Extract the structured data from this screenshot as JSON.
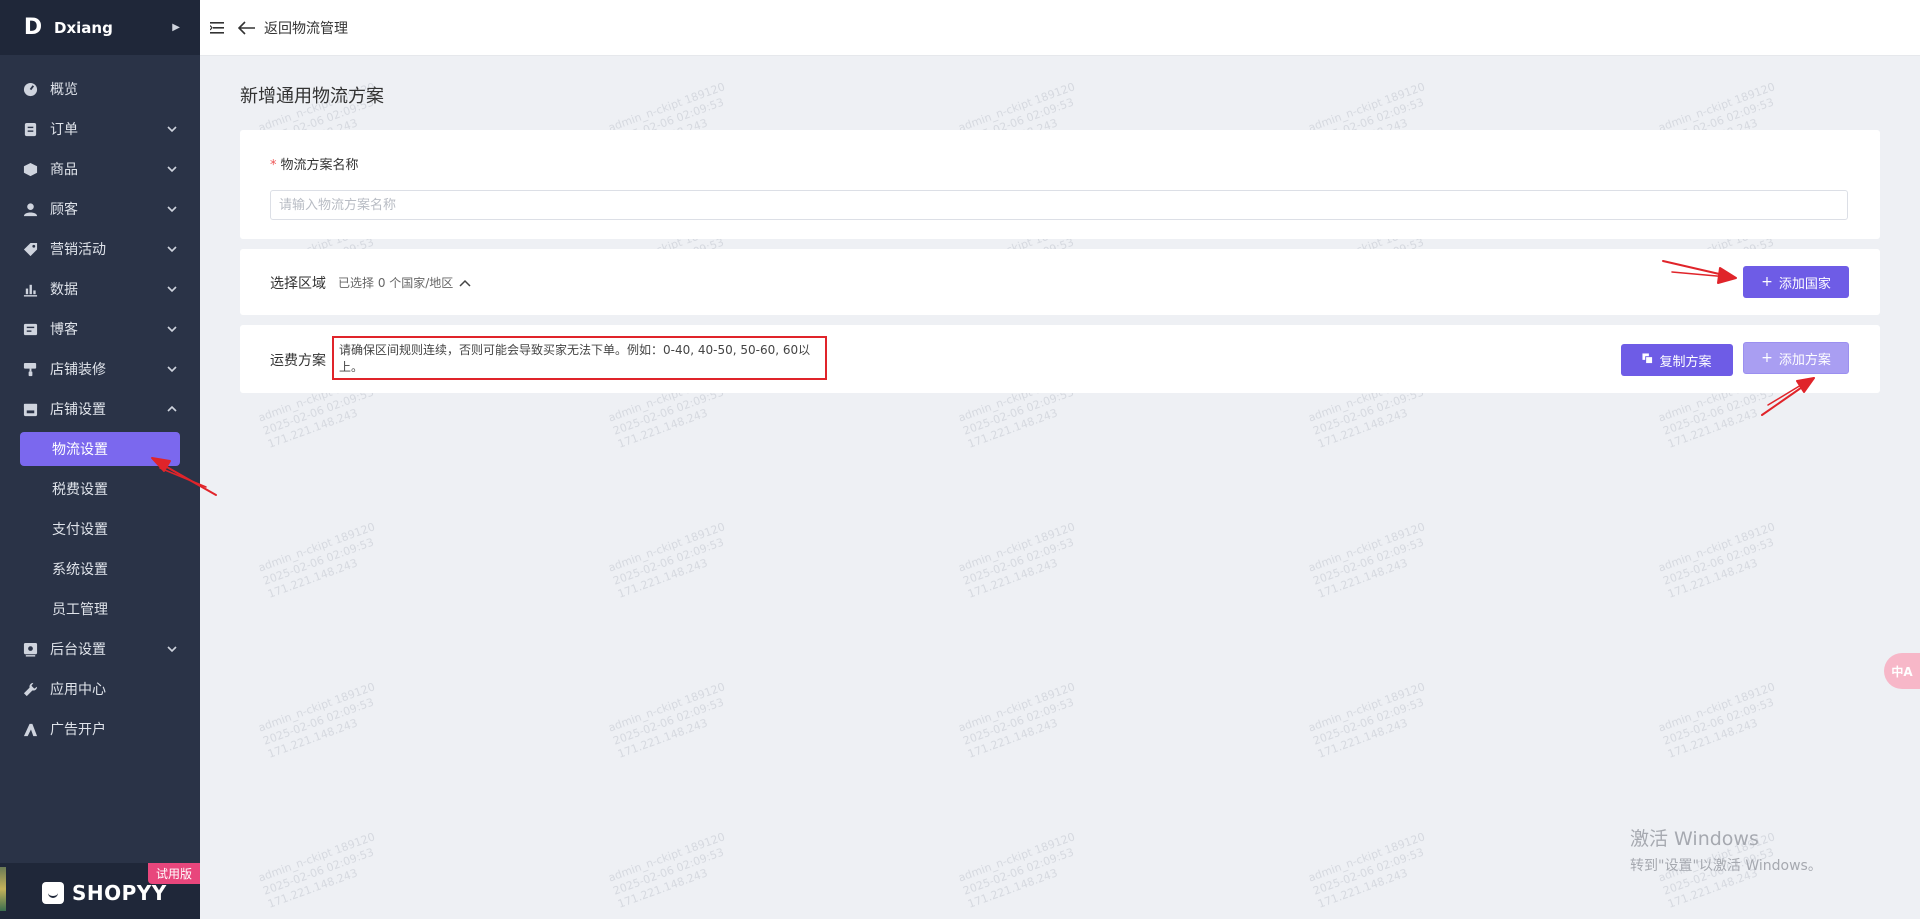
{
  "brand": {
    "letter": "D",
    "name": "Dxiang"
  },
  "sidebar": {
    "items": [
      {
        "label": "概览",
        "icon": "dashboard-icon",
        "has_chevron": false
      },
      {
        "label": "订单",
        "icon": "orders-icon",
        "has_chevron": true
      },
      {
        "label": "商品",
        "icon": "products-icon",
        "has_chevron": true
      },
      {
        "label": "顾客",
        "icon": "customers-icon",
        "has_chevron": true
      },
      {
        "label": "营销活动",
        "icon": "marketing-icon",
        "has_chevron": true
      },
      {
        "label": "数据",
        "icon": "data-icon",
        "has_chevron": true
      },
      {
        "label": "博客",
        "icon": "blog-icon",
        "has_chevron": true
      },
      {
        "label": "店铺装修",
        "icon": "decoration-icon",
        "has_chevron": true
      },
      {
        "label": "店铺设置",
        "icon": "store-settings-icon",
        "has_chevron": true,
        "expanded": true
      }
    ],
    "store_sub": [
      "物流设置",
      "税费设置",
      "支付设置",
      "系统设置",
      "员工管理"
    ],
    "bottom_items": [
      {
        "label": "后台设置",
        "icon": "admin-settings-icon",
        "has_chevron": true
      },
      {
        "label": "应用中心",
        "icon": "wrench-icon",
        "has_chevron": false
      },
      {
        "label": "广告开户",
        "icon": "ads-icon",
        "has_chevron": false
      }
    ],
    "footer_logo": "SHOPYY",
    "trial_badge": "试用版"
  },
  "topbar": {
    "back_label": "返回物流管理"
  },
  "page": {
    "title": "新增通用物流方案",
    "name_label": "物流方案名称",
    "name_placeholder": "请输入物流方案名称",
    "region_label": "选择区域",
    "region_count": "已选择 0 个国家/地区",
    "add_country": "添加国家",
    "fee_label": "运费方案",
    "notice": "请确保区间规则连续，否则可能会导致买家无法下单。例如：0-40, 40-50, 50-60, 60以上。",
    "copy_plan": "复制方案",
    "add_plan": "添加方案"
  },
  "watermark": {
    "line1": "admin_n-ckipt 189120",
    "line2": "2025-02-06 02:09:53",
    "line3": "171.221.148.243"
  },
  "translate_label": "中A",
  "windows_activation": {
    "line1": "激活 Windows",
    "line2": "转到\"设置\"以激活 Windows。"
  },
  "colors": {
    "accent": "#6e5ce6",
    "sidebar_bg": "#2a3347",
    "annotation_red": "#e0242a"
  }
}
